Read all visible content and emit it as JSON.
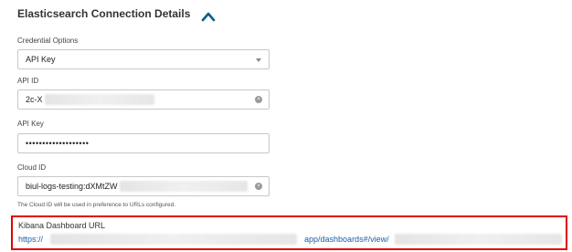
{
  "section": {
    "title": "Elasticsearch Connection Details"
  },
  "credential_options": {
    "label": "Credential Options",
    "value": "API Key"
  },
  "api_id": {
    "label": "API ID",
    "value": "2c-X"
  },
  "api_key": {
    "label": "API Key",
    "value": "•••••••••••••••••••"
  },
  "cloud_id": {
    "label": "Cloud ID",
    "value": "biul-logs-testing:dXMtZW",
    "helper": "The Cloud ID will be used in preference to URLs configured."
  },
  "kibana": {
    "label": "Kibana Dashboard URL",
    "url_prefix": "https://",
    "url_middle": "app/dashboards#/view/",
    "highlight_color": "#e00000"
  },
  "icons": {
    "collapse": "chevron-up-icon",
    "select": "caret-down-icon",
    "clear": "clear-icon"
  },
  "colors": {
    "accent": "#1a5fa8",
    "chevron": "#0b5e8a"
  }
}
